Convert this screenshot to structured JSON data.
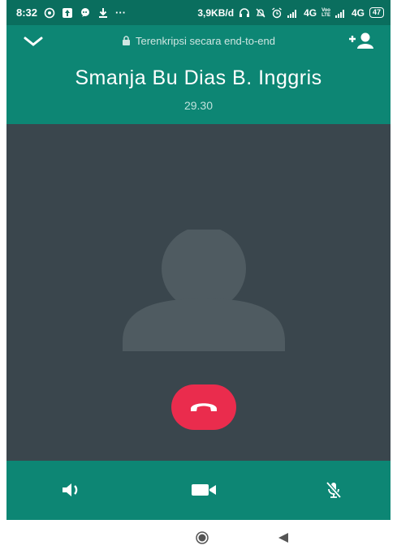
{
  "status_bar": {
    "time": "8:32",
    "net_speed": "3,9KB/d",
    "signal1": "4G",
    "volte_top": "Voo",
    "volte_bottom": "LTE",
    "signal2": "4G",
    "battery": "47",
    "more": "···"
  },
  "header": {
    "encryption_text": "Terenkripsi secara end-to-end",
    "contact_name": "Smanja Bu Dias B. Inggris",
    "call_timer": "29.30"
  },
  "icons": {
    "collapse": "chevron-down-icon",
    "lock": "lock-icon",
    "add_participant": "add-person-icon",
    "end_call": "end-call-icon",
    "speaker": "speaker-icon",
    "video": "video-camera-icon",
    "mute": "mic-off-icon",
    "home": "home-icon",
    "back": "back-icon"
  },
  "colors": {
    "header": "#0d8674",
    "status_bar": "#0a6e5e",
    "video_area": "#3a464d",
    "end_call": "#ea2c4d"
  }
}
